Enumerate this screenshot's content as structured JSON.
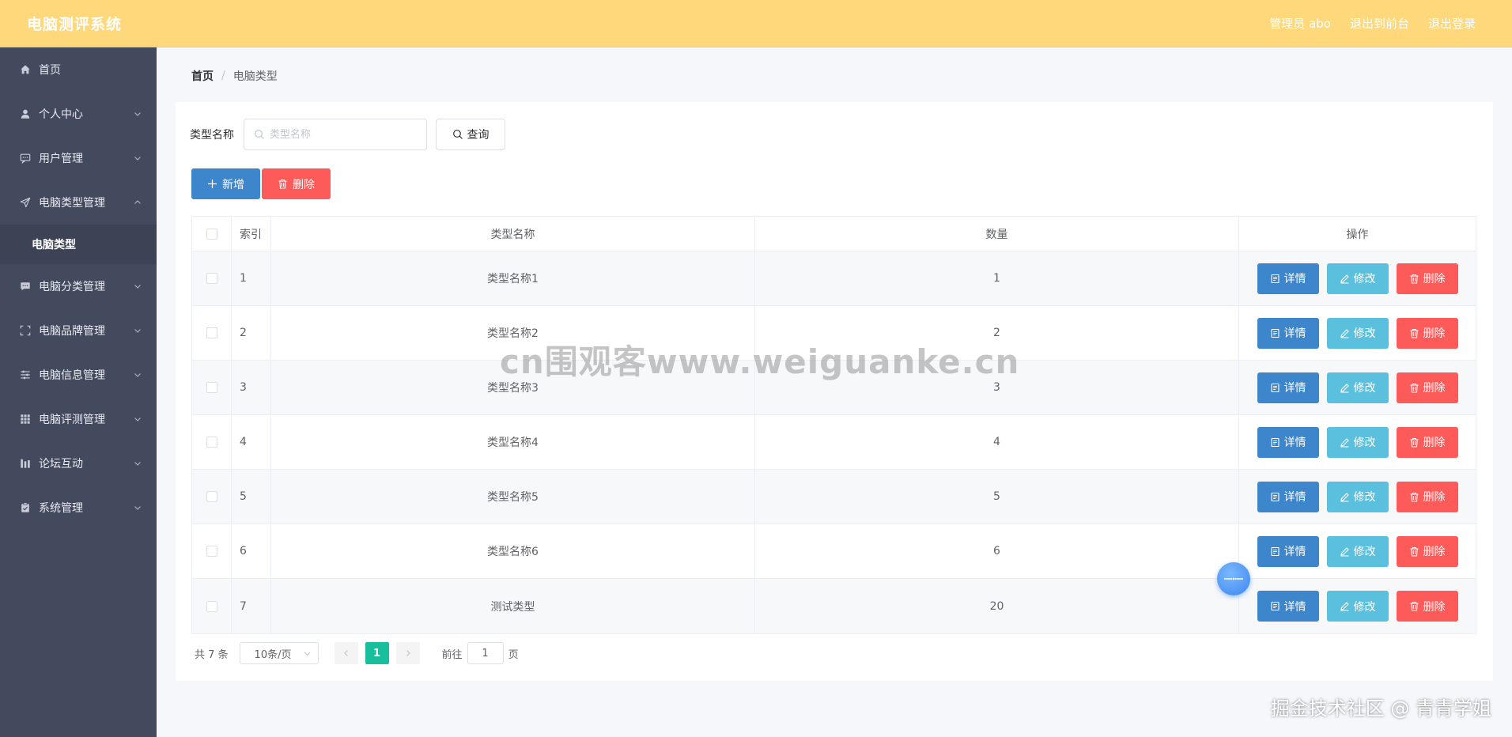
{
  "header": {
    "brand": "电脑测评系统",
    "nav": [
      {
        "label": "管理员 abo"
      },
      {
        "label": "退出到前台"
      },
      {
        "label": "退出登录"
      }
    ]
  },
  "sidebar": {
    "items": [
      {
        "label": "首页",
        "icon": "home-icon"
      },
      {
        "label": "个人中心",
        "icon": "user-icon"
      },
      {
        "label": "用户管理",
        "icon": "chat-icon"
      },
      {
        "label": "电脑类型管理",
        "icon": "send-icon",
        "expanded": true,
        "children": [
          {
            "label": "电脑类型"
          }
        ]
      },
      {
        "label": "电脑分类管理",
        "icon": "message-icon"
      },
      {
        "label": "电脑品牌管理",
        "icon": "fullscreen-icon"
      },
      {
        "label": "电脑信息管理",
        "icon": "sliders-icon"
      },
      {
        "label": "电脑评测管理",
        "icon": "grid-icon"
      },
      {
        "label": "论坛互动",
        "icon": "chart-icon"
      },
      {
        "label": "系统管理",
        "icon": "clipboard-icon"
      }
    ]
  },
  "breadcrumb": {
    "home": "首页",
    "separator": "/",
    "current": "电脑类型"
  },
  "search": {
    "label": "类型名称",
    "placeholder": "类型名称",
    "query_label": "查询"
  },
  "actions": {
    "add_label": "新增",
    "delete_label": "删除"
  },
  "table": {
    "headers": {
      "index": "索引",
      "name": "类型名称",
      "quantity": "数量",
      "operation": "操作"
    },
    "rows": [
      {
        "index": "1",
        "name": "类型名称1",
        "quantity": "1"
      },
      {
        "index": "2",
        "name": "类型名称2",
        "quantity": "2"
      },
      {
        "index": "3",
        "name": "类型名称3",
        "quantity": "3"
      },
      {
        "index": "4",
        "name": "类型名称4",
        "quantity": "4"
      },
      {
        "index": "5",
        "name": "类型名称5",
        "quantity": "5"
      },
      {
        "index": "6",
        "name": "类型名称6",
        "quantity": "6"
      },
      {
        "index": "7",
        "name": "测试类型",
        "quantity": "20"
      }
    ],
    "row_actions": {
      "detail": "详情",
      "edit": "修改",
      "delete": "删除"
    }
  },
  "pagination": {
    "total": "共 7 条",
    "page_size": "10条/页",
    "current_page": "1",
    "goto_prefix": "前往",
    "goto_value": "1",
    "goto_suffix": "页"
  },
  "watermark": "cn围观客www.weiguanke.cn",
  "credit": "掘金技术社区 @ 青青学姐",
  "colors": {
    "topbar": "#ffd87c",
    "sidebar": "#434a5e",
    "primary": "#3d86cc",
    "info": "#5bc0de",
    "danger": "#fd5a5a",
    "page_active": "#19be9c"
  }
}
